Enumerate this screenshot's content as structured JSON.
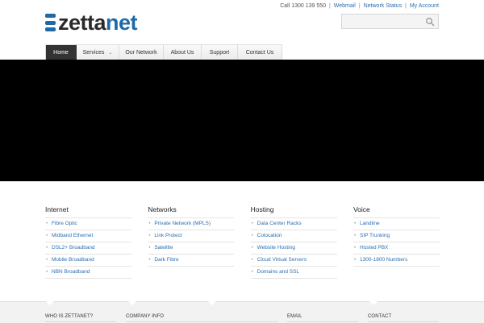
{
  "brand": {
    "name_left": "zetta",
    "name_right": "net"
  },
  "toplinks": {
    "phone": "Call 1300 139 550",
    "links": [
      "Webmail",
      "Network Status",
      "My Account"
    ],
    "separator": "|"
  },
  "search": {
    "placeholder": ""
  },
  "nav": {
    "items": [
      {
        "label": "Home",
        "active": true
      },
      {
        "label": "Services",
        "has_dropdown": true
      },
      {
        "label": "Our Network"
      },
      {
        "label": "About Us"
      },
      {
        "label": "Support"
      },
      {
        "label": "Contact Us"
      }
    ],
    "dropdown_glyph": "⌄"
  },
  "columns": [
    {
      "title": "Internet",
      "items": [
        "Fibre Optic",
        "Midband Ethernet",
        "DSL2+ Broadband",
        "Mobile Broadband",
        "NBN Broadband"
      ]
    },
    {
      "title": "Networks",
      "items": [
        "Private Network (MPLS)",
        "Link Protect",
        "Satellite",
        "Dark Fibre"
      ]
    },
    {
      "title": "Hosting",
      "items": [
        "Data Center Racks",
        "Colocation",
        "Website Hosting",
        "Cloud Virtual Servers",
        "Domains and SSL"
      ]
    },
    {
      "title": "Voice",
      "items": [
        "Landline",
        "SIP Trunking",
        "Hosted PBX",
        "1300-1800 Numbers"
      ]
    }
  ],
  "bullet": "•",
  "footer": {
    "headings": [
      "WHO IS ZETTANET?",
      "COMPANY INFO",
      "EMAIL",
      "CONTACT"
    ]
  },
  "colors": {
    "accent": "#1e6aa8",
    "link": "#2a6fb0",
    "hero": "#000000",
    "nav_active": "#333333"
  },
  "icons": {
    "search": "search-icon",
    "logo": "stacked-bars-logo-icon"
  }
}
